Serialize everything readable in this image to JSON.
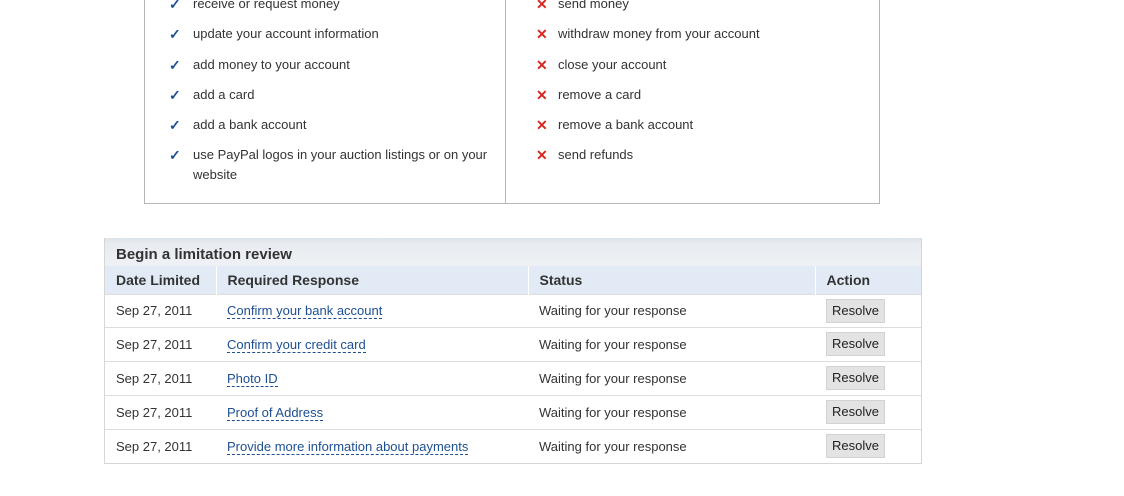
{
  "capabilities": {
    "can": [
      "receive or request money",
      "update your account information",
      "add money to your account",
      "add a card",
      "add a bank account",
      "use PayPal logos in your auction listings or on your website"
    ],
    "cannot": [
      "send money",
      "withdraw money from your account",
      "close your account",
      "remove a card",
      "remove a bank account",
      "send refunds"
    ],
    "can_mark": "✓",
    "cannot_mark": "✕",
    "can_color": "#1d4f91",
    "cannot_color": "#d6281f"
  },
  "review": {
    "title": "Begin a limitation review",
    "columns": {
      "date": "Date Limited",
      "response": "Required Response",
      "status": "Status",
      "action": "Action"
    },
    "rows": [
      {
        "date": "Sep 27, 2011",
        "response": "Confirm your bank account",
        "status": "Waiting for your response",
        "action": "Resolve"
      },
      {
        "date": "Sep 27, 2011",
        "response": "Confirm your credit card",
        "status": "Waiting for your response",
        "action": "Resolve"
      },
      {
        "date": "Sep 27, 2011",
        "response": "Photo ID",
        "status": "Waiting for your response",
        "action": "Resolve"
      },
      {
        "date": "Sep 27, 2011",
        "response": "Proof of Address",
        "status": "Waiting for your response",
        "action": "Resolve"
      },
      {
        "date": "Sep 27, 2011",
        "response": "Provide more information about payments",
        "status": "Waiting for your response",
        "action": "Resolve"
      }
    ],
    "link_color": "#1d4f91"
  }
}
